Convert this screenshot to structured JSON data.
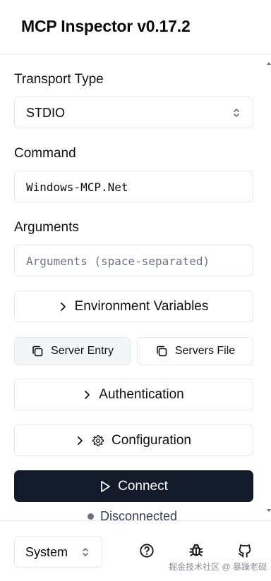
{
  "app": {
    "title": "MCP Inspector v0.17.2"
  },
  "transport": {
    "label": "Transport Type",
    "selected": "STDIO"
  },
  "command": {
    "label": "Command",
    "value": "Windows-MCP.Net"
  },
  "arguments": {
    "label": "Arguments",
    "placeholder": "Arguments (space-separated)"
  },
  "sections": {
    "env_label": "Environment Variables",
    "auth_label": "Authentication",
    "config_label": "Configuration"
  },
  "config_buttons": {
    "server_entry": "Server Entry",
    "servers_file": "Servers File"
  },
  "connect": {
    "label": "Connect"
  },
  "status": {
    "text": "Disconnected",
    "dot_color": "#6b7280"
  },
  "footer": {
    "theme": "System",
    "icons": [
      "help-icon",
      "bug-icon",
      "github-icon"
    ]
  },
  "watermark": "掘金技术社区 @ 暴躁老砚",
  "colors": {
    "primary": "#131a2a",
    "border": "#e5e7eb",
    "active_bg": "#f3f6f9"
  }
}
